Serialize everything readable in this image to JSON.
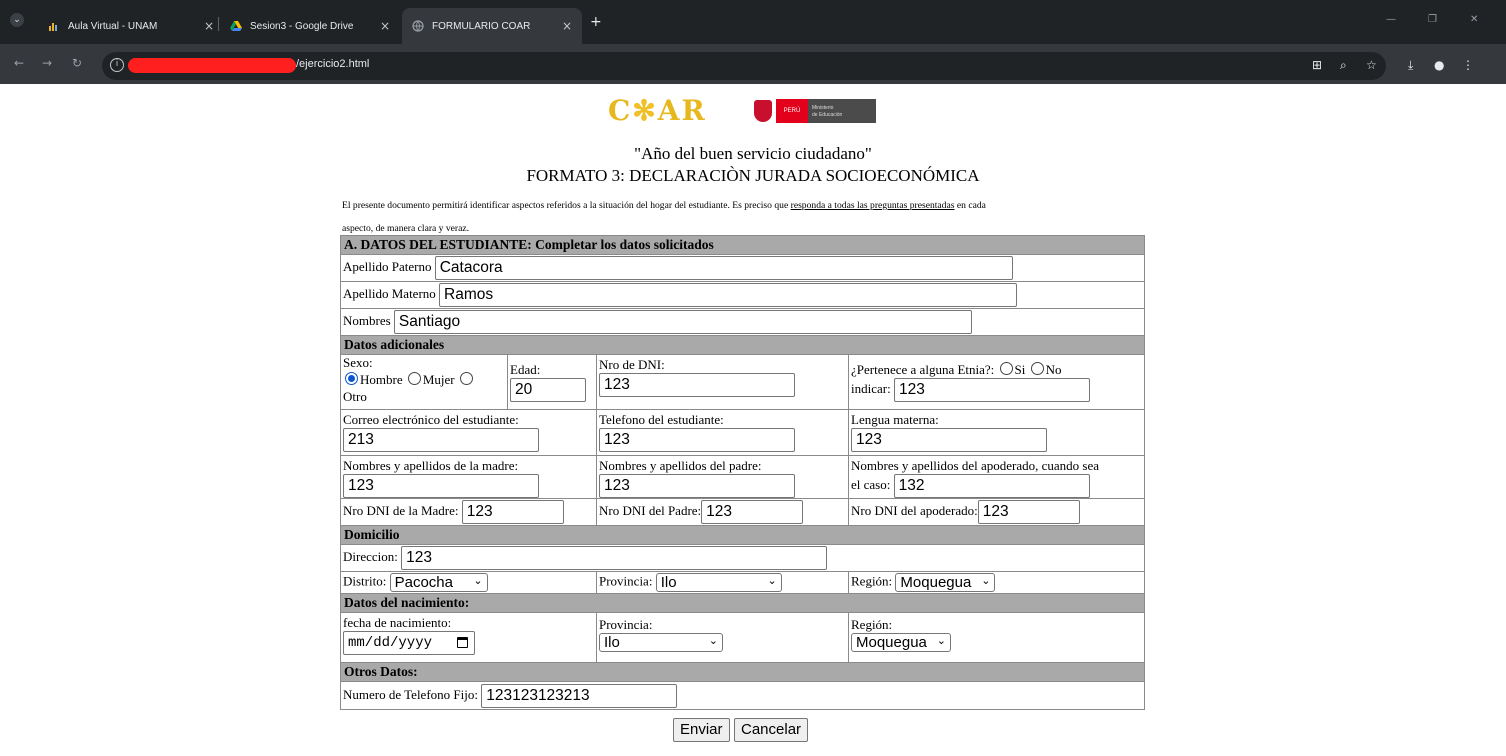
{
  "browser": {
    "tabs": [
      {
        "title": "Aula Virtual - UNAM"
      },
      {
        "title": "Sesion3 - Google Drive"
      },
      {
        "title": "FORMULARIO COAR"
      }
    ],
    "url_suffix": "/ejercicio2.html",
    "tab_close_glyph": "×",
    "newtab_glyph": "+"
  },
  "header": {
    "logo_text": "COAR",
    "peru_label": "PERÚ",
    "ministry_line1": "Ministerio",
    "ministry_line2": "de Educación",
    "motto": "\"Año del buen servicio ciudadano\"",
    "formato": "FORMATO 3: DECLARACIÒN JURADA SOCIOECONÓMICA"
  },
  "intro": {
    "part1": "El presente documento permitirá identificar aspectos referidos a la situación del hogar del estudiante. Es preciso que ",
    "underlined": "responda a todas las preguntas presentadas",
    "part2": " en cada aspecto, de manera clara y veraz."
  },
  "sections": {
    "estudiante": "A. DATOS DEL ESTUDIANTE: Completar los datos solicitados",
    "adicionales": "Datos adicionales",
    "domicilio": "Domicilio",
    "nacimiento": "Datos del nacimiento:",
    "otros": "Otros Datos:"
  },
  "estudiante": {
    "apellido_paterno_label": "Apellido Paterno",
    "apellido_paterno": "Catacora",
    "apellido_materno_label": "Apellido Materno",
    "apellido_materno": "Ramos",
    "nombres_label": "Nombres",
    "nombres": "Santiago"
  },
  "adicionales": {
    "sexo_label": "Sexo:",
    "sexo_options": [
      "Hombre",
      "Mujer",
      "Otro"
    ],
    "sexo_selected": "Hombre",
    "edad_label": "Edad:",
    "edad": "20",
    "dni_label": "Nro de DNI:",
    "dni": "123",
    "etnia_label": "¿Pertenece a alguna Etnia?:",
    "etnia_si": "Si",
    "etnia_no": "No",
    "indicar_label": "indicar:",
    "indicar": "123",
    "correo_label": "Correo electrónico del estudiante:",
    "correo": "213",
    "telefono_label": "Telefono del estudiante:",
    "telefono": "123",
    "lengua_label": "Lengua materna:",
    "lengua": "123",
    "madre_label": "Nombres y apellidos de la madre:",
    "madre": "123",
    "padre_label": "Nombres y apellidos del padre:",
    "padre": "123",
    "apoderado_label_1": "Nombres y apellidos del apoderado, cuando sea",
    "apoderado_label_2": "el caso:",
    "apoderado": "132",
    "dni_madre_label": "Nro DNI de la Madre:",
    "dni_madre": "123",
    "dni_padre_label": "Nro DNI del Padre:",
    "dni_padre": "123",
    "dni_apoderado_label": "Nro DNI del apoderado:",
    "dni_apoderado": "123"
  },
  "domicilio": {
    "direccion_label": "Direccion:",
    "direccion": "123",
    "distrito_label": "Distrito:",
    "distrito": "Pacocha",
    "provincia_label": "Provincia:",
    "provincia": "Ilo",
    "region_label": "Región:",
    "region": "Moquegua"
  },
  "nacimiento": {
    "fecha_label": "fecha de nacimiento:",
    "fecha_placeholder": "mm/dd/yyyy",
    "provincia_label": "Provincia:",
    "provincia": "Ilo",
    "region_label": "Región:",
    "region": "Moquegua"
  },
  "otros": {
    "telefono_fijo_label": "Numero de Telefono Fijo:",
    "telefono_fijo": "123123123213"
  },
  "buttons": {
    "enviar": "Enviar",
    "cancelar": "Cancelar"
  }
}
